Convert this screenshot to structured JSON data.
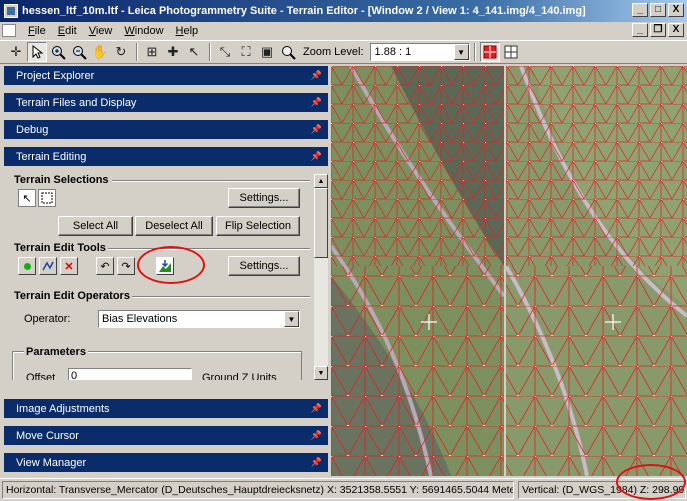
{
  "window": {
    "title": "hessen_ltf_10m.ltf - Leica Photogrammetry Suite - Terrain Editor - [Window 2 / View 1: 4_141.img/4_140.img]",
    "controls": [
      "_",
      "□",
      "X"
    ]
  },
  "menu": {
    "items": [
      "File",
      "Edit",
      "View",
      "Window",
      "Help"
    ],
    "mdi_controls": [
      "_",
      "❐",
      "X"
    ]
  },
  "toolbar": {
    "zoom_label": "Zoom Level:",
    "zoom_value": "1.88 : 1"
  },
  "sections": {
    "project_explorer": "Project Explorer",
    "terrain_files": "Terrain Files and Display",
    "debug": "Debug",
    "terrain_editing": "Terrain Editing",
    "image_adjustments": "Image Adjustments",
    "move_cursor": "Move Cursor",
    "view_manager": "View Manager"
  },
  "terrain_selections": {
    "title": "Terrain Selections",
    "settings_label": "Settings...",
    "select_all": "Select All",
    "deselect_all": "Deselect All",
    "flip_selection": "Flip Selection"
  },
  "terrain_edit_tools": {
    "title": "Terrain Edit Tools",
    "settings_label": "Settings..."
  },
  "terrain_edit_operators": {
    "title": "Terrain Edit Operators",
    "operator_label": "Operator:",
    "operator_value": "Bias Elevations"
  },
  "parameters": {
    "title": "Parameters",
    "offset_label": "Offset",
    "offset_value": "0",
    "units_label": "Ground Z Units"
  },
  "status": {
    "horizontal": "Horizontal: Transverse_Mercator (D_Deutsches_Hauptdreiecksnetz) X: 3521358.5551  Y: 5691465.5044 Meter",
    "vertical": "Vertical: (D_WGS_1984) Z: 298.99"
  },
  "colors": {
    "section_header": "#0a2c6a",
    "annotation": "#e01010",
    "tin_lines": "#e02020"
  }
}
